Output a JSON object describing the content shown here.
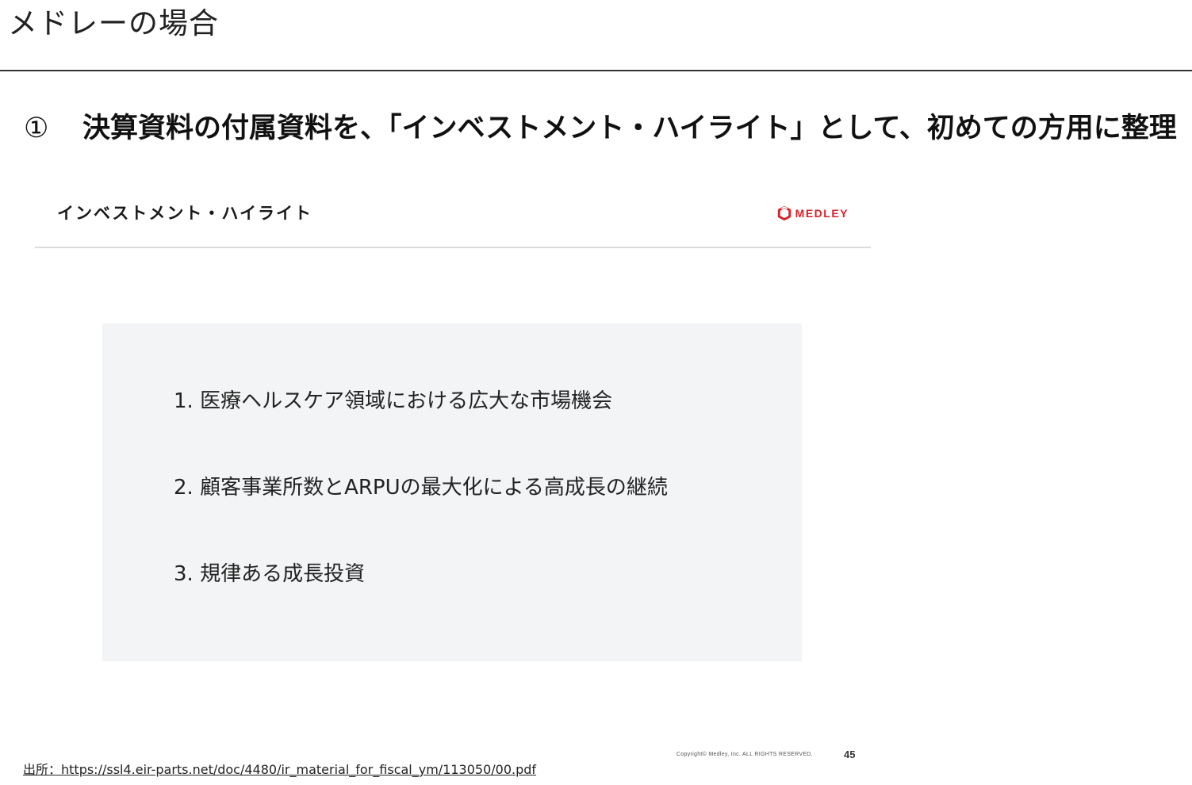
{
  "page": {
    "title": "メドレーの場合"
  },
  "headline": {
    "number": "①",
    "text": "決算資料の付属資料を、「インベストメント・ハイライト」として、初めての方用に整理"
  },
  "slide": {
    "header_title": "インベストメント・ハイライト",
    "logo_text": "MEDLEY",
    "logo_color": "#d6212b",
    "items": [
      {
        "label": "1. 医療ヘルスケア領域における広大な市場機会"
      },
      {
        "label": "2. 顧客事業所数とARPUの最大化による高成長の継続"
      },
      {
        "label": "3. 規律ある成長投資"
      }
    ],
    "copyright": "Copyright© Medley, Inc. ALL RIGHTS RESERVED.",
    "page_number": "45"
  },
  "source": {
    "text": "出所：https://ssl4.eir-parts.net/doc/4480/ir_material_for_fiscal_ym/113050/00.pdf"
  }
}
